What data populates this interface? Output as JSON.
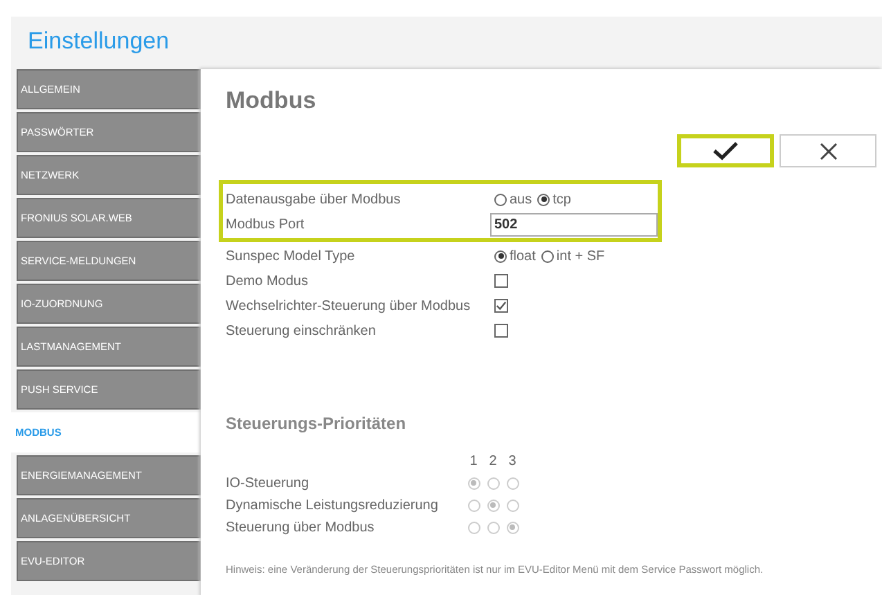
{
  "header": {
    "title": "Einstellungen"
  },
  "sidebar": {
    "items": [
      {
        "label": "ALLGEMEIN",
        "selected": false
      },
      {
        "label": "PASSWÖRTER",
        "selected": false
      },
      {
        "label": "NETZWERK",
        "selected": false
      },
      {
        "label": "FRONIUS SOLAR.WEB",
        "selected": false
      },
      {
        "label": "SERVICE-MELDUNGEN",
        "selected": false
      },
      {
        "label": "IO-ZUORDNUNG",
        "selected": false
      },
      {
        "label": "LASTMANAGEMENT",
        "selected": false
      },
      {
        "label": "PUSH SERVICE",
        "selected": false
      },
      {
        "label": "MODBUS",
        "selected": true
      },
      {
        "label": "ENERGIEMANAGEMENT",
        "selected": false
      },
      {
        "label": "ANLAGENÜBERSICHT",
        "selected": false
      },
      {
        "label": "EVU-EDITOR",
        "selected": false
      }
    ]
  },
  "page": {
    "title": "Modbus",
    "buttons": [
      {
        "kind": "confirm",
        "highlighted": true
      },
      {
        "kind": "cancel",
        "highlighted": false
      }
    ],
    "setting_groups": [
      {
        "highlighted": true,
        "rows": [
          {
            "label": "Datenausgabe über Modbus",
            "kind": "radio",
            "options": [
              {
                "label": "aus",
                "selected": false
              },
              {
                "label": "tcp",
                "selected": true
              }
            ]
          },
          {
            "label": "Modbus Port",
            "kind": "text",
            "value": "502"
          }
        ]
      },
      {
        "highlighted": false,
        "rows": [
          {
            "label": "Sunspec Model Type",
            "kind": "radio",
            "options": [
              {
                "label": "float",
                "selected": true
              },
              {
                "label": "int + SF",
                "selected": false
              }
            ]
          },
          {
            "label": "Demo Modus",
            "kind": "checkbox",
            "checked": false
          },
          {
            "label": "Wechselrichter-Steuerung über Modbus",
            "kind": "checkbox",
            "checked": true
          },
          {
            "label": "Steuerung einschränken",
            "kind": "checkbox",
            "checked": false
          }
        ]
      }
    ],
    "priorities": {
      "title": "Steuerungs-Prioritäten",
      "disabled": true,
      "columns": [
        "1",
        "2",
        "3"
      ],
      "rows": [
        {
          "label": "IO-Steuerung",
          "options": [
            {
              "selected": true
            },
            {
              "selected": false
            },
            {
              "selected": false
            }
          ]
        },
        {
          "label": "Dynamische Leistungsreduzierung",
          "options": [
            {
              "selected": false
            },
            {
              "selected": true
            },
            {
              "selected": false
            }
          ]
        },
        {
          "label": "Steuerung über Modbus",
          "options": [
            {
              "selected": false
            },
            {
              "selected": false
            },
            {
              "selected": true
            }
          ]
        }
      ]
    },
    "note": "Hinweis: eine Veränderung der Steuerungsprioritäten ist nur im EVU-Editor Menü mit dem Service Passwort möglich."
  }
}
